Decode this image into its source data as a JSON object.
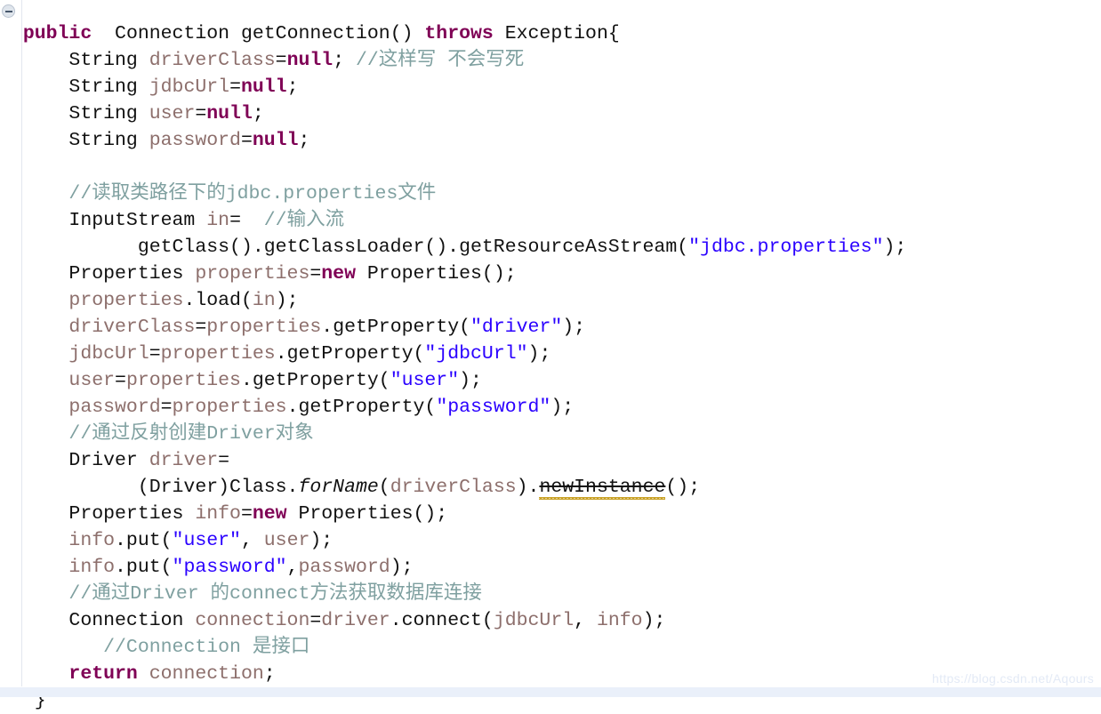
{
  "editor": {
    "language": "java",
    "background": "#ffffff",
    "gutter_line_color": "#e3e7ee",
    "fold_icon": "collapse-minus-icon",
    "font_size_px": 21.5,
    "line_height_px": 30,
    "colors": {
      "keyword": "#7f0055",
      "type": "#111111",
      "variable": "#8d6f6c",
      "string": "#2a00ff",
      "comment": "#7fa0a0",
      "deprecated_underline": "#c9a227",
      "watermark": "#e3eaf6",
      "bottom_strip": "#eaf0fa"
    }
  },
  "watermark": {
    "text": "https://blog.csdn.net/Aqours"
  },
  "code": {
    "lines": [
      {
        "id": "line-method-signature",
        "tokens": [
          {
            "t": "  ",
            "c": "pun"
          },
          {
            "t": "public",
            "c": "kw"
          },
          {
            "t": "  ",
            "c": "pun"
          },
          {
            "t": "Connection getConnection() ",
            "c": "typ"
          },
          {
            "t": "throws",
            "c": "kw"
          },
          {
            "t": " Exception{",
            "c": "typ"
          }
        ]
      },
      {
        "id": "line-declare-driverclass",
        "tokens": [
          {
            "t": "      String ",
            "c": "typ"
          },
          {
            "t": "driverClass",
            "c": "var"
          },
          {
            "t": "=",
            "c": "pun"
          },
          {
            "t": "null",
            "c": "kw"
          },
          {
            "t": "; ",
            "c": "pun"
          },
          {
            "t": "//这样写 不会写死",
            "c": "cmt"
          }
        ]
      },
      {
        "id": "line-declare-jdbcurl",
        "tokens": [
          {
            "t": "      String ",
            "c": "typ"
          },
          {
            "t": "jdbcUrl",
            "c": "var"
          },
          {
            "t": "=",
            "c": "pun"
          },
          {
            "t": "null",
            "c": "kw"
          },
          {
            "t": ";",
            "c": "pun"
          }
        ]
      },
      {
        "id": "line-declare-user",
        "tokens": [
          {
            "t": "      String ",
            "c": "typ"
          },
          {
            "t": "user",
            "c": "var"
          },
          {
            "t": "=",
            "c": "pun"
          },
          {
            "t": "null",
            "c": "kw"
          },
          {
            "t": ";",
            "c": "pun"
          }
        ]
      },
      {
        "id": "line-declare-password",
        "tokens": [
          {
            "t": "      String ",
            "c": "typ"
          },
          {
            "t": "password",
            "c": "var"
          },
          {
            "t": "=",
            "c": "pun"
          },
          {
            "t": "null",
            "c": "kw"
          },
          {
            "t": ";",
            "c": "pun"
          }
        ]
      },
      {
        "id": "line-blank-1",
        "tokens": [
          {
            "t": " ",
            "c": "pun"
          }
        ]
      },
      {
        "id": "line-comment-read-properties",
        "tokens": [
          {
            "t": "      ",
            "c": "pun"
          },
          {
            "t": "//读取类路径下的jdbc.properties文件",
            "c": "cmt"
          }
        ]
      },
      {
        "id": "line-inputstream-decl",
        "tokens": [
          {
            "t": "      InputStream ",
            "c": "typ"
          },
          {
            "t": "in",
            "c": "var"
          },
          {
            "t": "=  ",
            "c": "pun"
          },
          {
            "t": "//输入流",
            "c": "cmt"
          }
        ]
      },
      {
        "id": "line-getresourceasstream",
        "tokens": [
          {
            "t": "            getClass().getClassLoader().getResourceAsStream(",
            "c": "typ"
          },
          {
            "t": "\"jdbc.properties\"",
            "c": "str"
          },
          {
            "t": ");",
            "c": "pun"
          }
        ]
      },
      {
        "id": "line-new-properties",
        "tokens": [
          {
            "t": "      Properties ",
            "c": "typ"
          },
          {
            "t": "properties",
            "c": "var"
          },
          {
            "t": "=",
            "c": "pun"
          },
          {
            "t": "new",
            "c": "kw"
          },
          {
            "t": " Properties();",
            "c": "typ"
          }
        ]
      },
      {
        "id": "line-properties-load",
        "tokens": [
          {
            "t": "      ",
            "c": "pun"
          },
          {
            "t": "properties",
            "c": "var"
          },
          {
            "t": ".load(",
            "c": "typ"
          },
          {
            "t": "in",
            "c": "var"
          },
          {
            "t": ");",
            "c": "pun"
          }
        ]
      },
      {
        "id": "line-get-driver",
        "tokens": [
          {
            "t": "      ",
            "c": "pun"
          },
          {
            "t": "driverClass",
            "c": "var"
          },
          {
            "t": "=",
            "c": "pun"
          },
          {
            "t": "properties",
            "c": "var"
          },
          {
            "t": ".getProperty(",
            "c": "typ"
          },
          {
            "t": "\"driver\"",
            "c": "str"
          },
          {
            "t": ");",
            "c": "pun"
          }
        ]
      },
      {
        "id": "line-get-jdbcurl",
        "tokens": [
          {
            "t": "      ",
            "c": "pun"
          },
          {
            "t": "jdbcUrl",
            "c": "var"
          },
          {
            "t": "=",
            "c": "pun"
          },
          {
            "t": "properties",
            "c": "var"
          },
          {
            "t": ".getProperty(",
            "c": "typ"
          },
          {
            "t": "\"jdbcUrl\"",
            "c": "str"
          },
          {
            "t": ");",
            "c": "pun"
          }
        ]
      },
      {
        "id": "line-get-user",
        "tokens": [
          {
            "t": "      ",
            "c": "pun"
          },
          {
            "t": "user",
            "c": "var"
          },
          {
            "t": "=",
            "c": "pun"
          },
          {
            "t": "properties",
            "c": "var"
          },
          {
            "t": ".getProperty(",
            "c": "typ"
          },
          {
            "t": "\"user\"",
            "c": "str"
          },
          {
            "t": ");",
            "c": "pun"
          }
        ]
      },
      {
        "id": "line-get-password",
        "tokens": [
          {
            "t": "      ",
            "c": "pun"
          },
          {
            "t": "password",
            "c": "var"
          },
          {
            "t": "=",
            "c": "pun"
          },
          {
            "t": "properties",
            "c": "var"
          },
          {
            "t": ".getProperty(",
            "c": "typ"
          },
          {
            "t": "\"password\"",
            "c": "str"
          },
          {
            "t": ");",
            "c": "pun"
          }
        ]
      },
      {
        "id": "line-comment-reflection",
        "tokens": [
          {
            "t": "      ",
            "c": "pun"
          },
          {
            "t": "//通过反射创建Driver对象",
            "c": "cmt"
          }
        ]
      },
      {
        "id": "line-driver-decl",
        "tokens": [
          {
            "t": "      Driver ",
            "c": "typ"
          },
          {
            "t": "driver",
            "c": "var"
          },
          {
            "t": "=",
            "c": "pun"
          }
        ]
      },
      {
        "id": "line-class-forname",
        "tokens": [
          {
            "t": "            (Driver)Class.",
            "c": "typ"
          },
          {
            "t": "forName",
            "c": "stat"
          },
          {
            "t": "(",
            "c": "typ"
          },
          {
            "t": "driverClass",
            "c": "var"
          },
          {
            "t": ").",
            "c": "typ"
          },
          {
            "t": "newInstance",
            "c": "dep"
          },
          {
            "t": "();",
            "c": "typ"
          }
        ]
      },
      {
        "id": "line-new-info",
        "tokens": [
          {
            "t": "      Properties ",
            "c": "typ"
          },
          {
            "t": "info",
            "c": "var"
          },
          {
            "t": "=",
            "c": "pun"
          },
          {
            "t": "new",
            "c": "kw"
          },
          {
            "t": " Properties();",
            "c": "typ"
          }
        ]
      },
      {
        "id": "line-info-put-user",
        "tokens": [
          {
            "t": "      ",
            "c": "pun"
          },
          {
            "t": "info",
            "c": "var"
          },
          {
            "t": ".put(",
            "c": "typ"
          },
          {
            "t": "\"user\"",
            "c": "str"
          },
          {
            "t": ", ",
            "c": "pun"
          },
          {
            "t": "user",
            "c": "var"
          },
          {
            "t": ");",
            "c": "pun"
          }
        ]
      },
      {
        "id": "line-info-put-password",
        "tokens": [
          {
            "t": "      ",
            "c": "pun"
          },
          {
            "t": "info",
            "c": "var"
          },
          {
            "t": ".put(",
            "c": "typ"
          },
          {
            "t": "\"password\"",
            "c": "str"
          },
          {
            "t": ",",
            "c": "pun"
          },
          {
            "t": "password",
            "c": "var"
          },
          {
            "t": ");",
            "c": "pun"
          }
        ]
      },
      {
        "id": "line-comment-connect",
        "tokens": [
          {
            "t": "      ",
            "c": "pun"
          },
          {
            "t": "//通过Driver 的connect方法获取数据库连接",
            "c": "cmt"
          }
        ]
      },
      {
        "id": "line-connection-assign",
        "tokens": [
          {
            "t": "      Connection ",
            "c": "typ"
          },
          {
            "t": "connection",
            "c": "var"
          },
          {
            "t": "=",
            "c": "pun"
          },
          {
            "t": "driver",
            "c": "var"
          },
          {
            "t": ".connect(",
            "c": "typ"
          },
          {
            "t": "jdbcUrl",
            "c": "var"
          },
          {
            "t": ", ",
            "c": "pun"
          },
          {
            "t": "info",
            "c": "var"
          },
          {
            "t": ");",
            "c": "pun"
          }
        ]
      },
      {
        "id": "line-comment-connection-interface",
        "tokens": [
          {
            "t": "         ",
            "c": "pun"
          },
          {
            "t": "//Connection 是接口",
            "c": "cmt"
          }
        ]
      },
      {
        "id": "line-return",
        "tokens": [
          {
            "t": "      ",
            "c": "pun"
          },
          {
            "t": "return",
            "c": "kw"
          },
          {
            "t": " ",
            "c": "pun"
          },
          {
            "t": "connection",
            "c": "var"
          },
          {
            "t": ";",
            "c": "pun"
          }
        ]
      },
      {
        "id": "line-close-brace",
        "tokens": [
          {
            "t": "   }",
            "c": "typ"
          }
        ]
      }
    ]
  }
}
